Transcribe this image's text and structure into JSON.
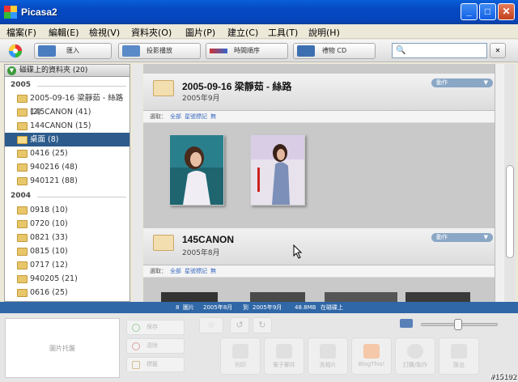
{
  "window": {
    "title": "Picasa2",
    "minimize": "_",
    "maximize": "□",
    "close": "✕"
  },
  "menu": [
    "檔案(F)",
    "編輯(E)",
    "檢視(V)",
    "資料夾(O)",
    "圖片(P)",
    "建立(C)",
    "工具(T)",
    "說明(H)"
  ],
  "toolbar": {
    "import": "匯入",
    "slideshow": "投影播放",
    "timeline": "時間順序",
    "gift_cd": "禮物 CD",
    "search_placeholder": "",
    "search_btn": "✕"
  },
  "sidebar": {
    "header": "磁碟上的資料夾 (20)",
    "years": [
      {
        "label": "2005",
        "items": [
          {
            "label": "2005-09-16 梁靜茹 - 絲路 (2)",
            "selected": false
          },
          {
            "label": "145CANON (41)",
            "selected": false
          },
          {
            "label": "144CANON (15)",
            "selected": false
          },
          {
            "label": "桌面 (8)",
            "selected": true
          },
          {
            "label": "0416 (25)",
            "selected": false
          },
          {
            "label": "940216 (48)",
            "selected": false
          },
          {
            "label": "940121 (88)",
            "selected": false
          }
        ]
      },
      {
        "label": "2004",
        "items": [
          {
            "label": "0918 (10)",
            "selected": false
          },
          {
            "label": "0720 (10)",
            "selected": false
          },
          {
            "label": "0821 (33)",
            "selected": false
          },
          {
            "label": "0815 (10)",
            "selected": false
          },
          {
            "label": "0717 (12)",
            "selected": false
          },
          {
            "label": "940205 (21)",
            "selected": false
          },
          {
            "label": "0616 (25)",
            "selected": false
          }
        ]
      }
    ]
  },
  "groups": [
    {
      "title": "2005-09-16 梁靜茹 - 絲路",
      "date": "2005年9月",
      "action": "動作",
      "select_label": "選取：",
      "select_all": "全部",
      "select_starred": "星號標記",
      "select_none": "無"
    },
    {
      "title": "145CANON",
      "date": "2005年8月",
      "action": "動作",
      "select_label": "選取：",
      "select_all": "全部",
      "select_starred": "星號標記",
      "select_none": "無"
    }
  ],
  "status": {
    "count": "8",
    "count_unit": "圖片",
    "from": "2005年8月",
    "to_label": "到",
    "to": "2005年9月",
    "size": "48.8MB",
    "size_suffix": "在磁碟上"
  },
  "bottom": {
    "tray_label": "圖片托盤",
    "hold": "保存",
    "clear": "清除",
    "label": "標籤",
    "actions": [
      "列印",
      "電子郵件",
      "洗相片",
      "BlogThis!",
      "訂購/製作",
      "匯出"
    ]
  },
  "watermark": "#15102"
}
